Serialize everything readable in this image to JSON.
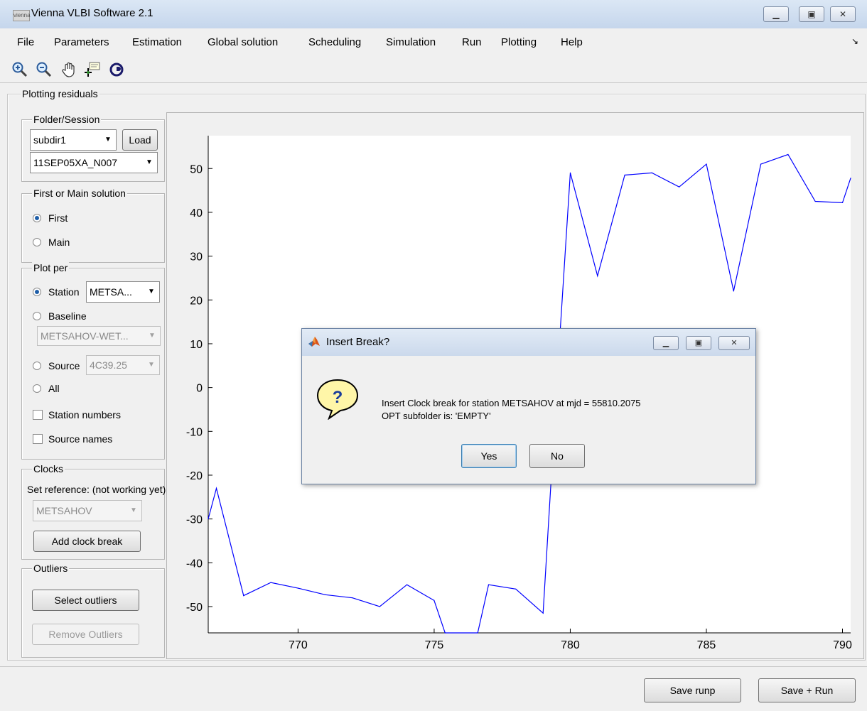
{
  "window": {
    "title": "Vienna VLBI Software 2.1",
    "icon_text": "vienna"
  },
  "menu": {
    "items": [
      "File",
      "Parameters",
      "Estimation",
      "Global solution",
      "Scheduling",
      "Simulation",
      "Run",
      "Plotting",
      "Help"
    ],
    "overflow_glyph": "↘"
  },
  "toolbar": {
    "icons": [
      "zoom-in-icon",
      "zoom-out-icon",
      "pan-hand-icon",
      "data-cursor-icon",
      "rotate-3d-icon"
    ]
  },
  "panel": {
    "title": "Plotting residuals",
    "folder_session": {
      "title": "Folder/Session",
      "folder": "subdir1",
      "load_label": "Load",
      "session": "11SEP05XA_N007"
    },
    "solution": {
      "title": "First or Main solution",
      "first_label": "First",
      "main_label": "Main",
      "selected": "First"
    },
    "plot_per": {
      "title": "Plot per",
      "station_label": "Station",
      "station_value": "METSA...",
      "baseline_label": "Baseline",
      "baseline_value": "METSAHOV-WET...",
      "source_label": "Source",
      "source_value": "4C39.25",
      "all_label": "All",
      "station_numbers_label": "Station numbers",
      "source_names_label": "Source names",
      "selected": "Station"
    },
    "clocks": {
      "title": "Clocks",
      "set_reference_label": "Set reference: (not working yet)",
      "reference_value": "METSAHOV",
      "add_clock_break_label": "Add clock break"
    },
    "outliers": {
      "title": "Outliers",
      "select_label": "Select outliers",
      "remove_label": "Remove Outliers"
    }
  },
  "chart_data": {
    "type": "line",
    "title": "",
    "xlabel": "",
    "ylabel": "",
    "xlim": [
      766.7,
      790.3
    ],
    "ylim": [
      -56,
      57.5
    ],
    "xticks": [
      770,
      775,
      780,
      785,
      790
    ],
    "yticks": [
      50,
      40,
      30,
      20,
      10,
      0,
      -10,
      -20,
      -30,
      -40,
      -50
    ],
    "color": "#0000ff",
    "x": [
      766.7,
      767.0,
      768.0,
      769.0,
      770.0,
      771.0,
      772.0,
      773.0,
      774.0,
      775.0,
      775.4,
      776.6,
      777.0,
      778.0,
      779.0,
      779.6,
      780.0,
      781.0,
      782.0,
      783.0,
      784.0,
      785.0,
      786.0,
      787.0,
      788.0,
      789.0,
      790.0,
      790.3
    ],
    "y": [
      -30.0,
      -23.0,
      -47.5,
      -44.5,
      -45.8,
      -47.3,
      -48.0,
      -50.0,
      -45.0,
      -48.6,
      -56.0,
      -56.0,
      -45.0,
      -46.0,
      -51.5,
      10.0,
      49.0,
      25.5,
      48.5,
      49.0,
      45.8,
      51.0,
      22.0,
      51.0,
      53.2,
      42.5,
      42.2,
      47.8
    ]
  },
  "dialog": {
    "title": "Insert Break?",
    "icon_glyph": "?",
    "message_line1": "Insert Clock break for station METSAHOV at mjd = 55810.2075",
    "message_line2": "OPT subfolder is: 'EMPTY'",
    "yes_label": "Yes",
    "no_label": "No"
  },
  "bottom": {
    "save_runp_label": "Save runp",
    "save_run_label": "Save + Run"
  },
  "colors": {
    "accent": "#1e5ea8",
    "plot_line": "#0000ff",
    "titlebar": "#c5d6ec"
  }
}
